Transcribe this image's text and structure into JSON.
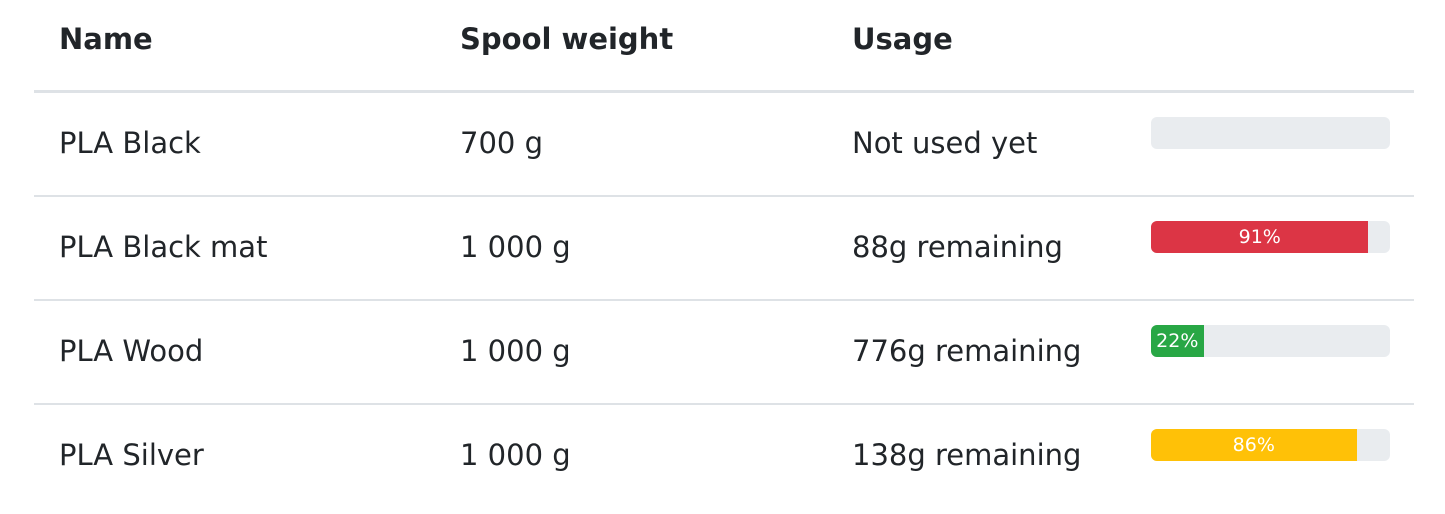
{
  "table": {
    "headers": {
      "name": "Name",
      "weight": "Spool weight",
      "usage": "Usage"
    },
    "rows": [
      {
        "name": "PLA Black",
        "weight": "700 g",
        "usage": "Not used yet",
        "progress": {
          "value": 0,
          "label": "",
          "color": "#6c757d"
        }
      },
      {
        "name": "PLA Black mat",
        "weight": "1 000 g",
        "usage": "88g remaining",
        "progress": {
          "value": 91,
          "label": "91%",
          "color": "#dc3545"
        }
      },
      {
        "name": "PLA Wood",
        "weight": "1 000 g",
        "usage": "776g remaining",
        "progress": {
          "value": 22,
          "label": "22%",
          "color": "#28a745"
        }
      },
      {
        "name": "PLA Silver",
        "weight": "1 000 g",
        "usage": "138g remaining",
        "progress": {
          "value": 86,
          "label": "86%",
          "color": "#ffc107"
        }
      }
    ]
  }
}
